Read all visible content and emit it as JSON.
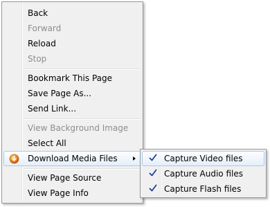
{
  "context_menu": {
    "items": [
      {
        "label": "Back",
        "enabled": true
      },
      {
        "label": "Forward",
        "enabled": false
      },
      {
        "label": "Reload",
        "enabled": true
      },
      {
        "label": "Stop",
        "enabled": false
      },
      {
        "label": "Bookmark This Page",
        "enabled": true
      },
      {
        "label": "Save Page As...",
        "enabled": true
      },
      {
        "label": "Send Link...",
        "enabled": true
      },
      {
        "label": "View Background Image",
        "enabled": false
      },
      {
        "label": "Select All",
        "enabled": true
      },
      {
        "label": "Download Media Files",
        "enabled": true,
        "has_submenu": true,
        "icon": "media-download-icon"
      },
      {
        "label": "View Page Source",
        "enabled": true
      },
      {
        "label": "View Page Info",
        "enabled": true
      }
    ]
  },
  "submenu": {
    "items": [
      {
        "label": "Capture Video files",
        "checked": true
      },
      {
        "label": "Capture Audio files",
        "checked": true
      },
      {
        "label": "Capture Flash files",
        "checked": true
      }
    ]
  },
  "colors": {
    "menu_background": "#f0f0f0",
    "menu_border": "#979797",
    "disabled_text": "#8d8d8d",
    "highlight_border": "#a8c8ec",
    "highlight_fill": "#e4effb",
    "check_color": "#1c3f94"
  }
}
